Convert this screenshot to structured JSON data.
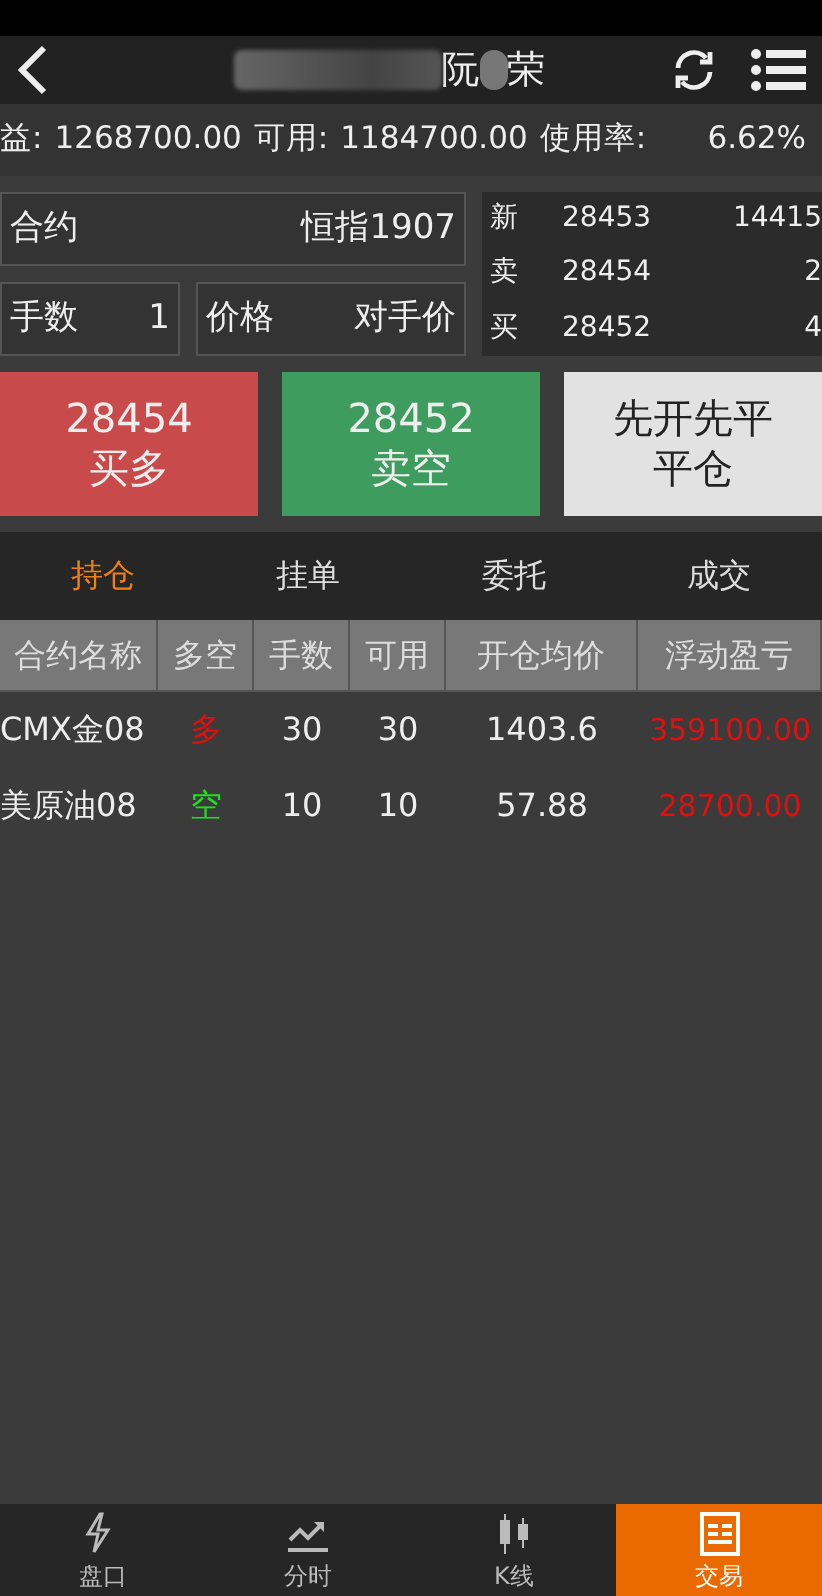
{
  "header": {
    "title_parts": [
      "阮",
      "荣"
    ]
  },
  "account": {
    "equity_label": "益:",
    "equity": "1268700.00",
    "available_label": "可用:",
    "available": "1184700.00",
    "usage_label": "使用率:",
    "usage": "6.62%"
  },
  "order": {
    "contract_label": "合约",
    "contract": "恒指1907",
    "qty_label": "手数",
    "qty": "1",
    "price_label": "价格",
    "price": "对手价"
  },
  "quote": [
    {
      "label": "新",
      "price": "28453",
      "volume": "14415"
    },
    {
      "label": "卖",
      "price": "28454",
      "volume": "2"
    },
    {
      "label": "买",
      "price": "28452",
      "volume": "4"
    }
  ],
  "actions": [
    {
      "kind": "buy",
      "price": "28454",
      "label": "买多"
    },
    {
      "kind": "sell",
      "price": "28452",
      "label": "卖空"
    },
    {
      "kind": "close",
      "price": "先开先平",
      "label": "平仓"
    }
  ],
  "tabs": [
    {
      "label": "持仓",
      "selected": true
    },
    {
      "label": "挂单",
      "selected": false
    },
    {
      "label": "委托",
      "selected": false
    },
    {
      "label": "成交",
      "selected": false
    }
  ],
  "table": {
    "columns": [
      "合约名称",
      "多空",
      "手数",
      "可用",
      "开仓均价",
      "浮动盈亏"
    ],
    "rows": [
      {
        "name": "CMX金08",
        "color": "#e01010",
        "direction": "多",
        "qty": "30",
        "available": "30",
        "avg_price": "1403.6",
        "pnl": "359100.00"
      },
      {
        "name": "美原油08",
        "color": "#22dd22",
        "direction": "空",
        "qty": "10",
        "available": "10",
        "avg_price": "57.88",
        "pnl": "28700.00"
      }
    ]
  },
  "nav": [
    {
      "kind": "bolt",
      "label": "盘口",
      "selected": false
    },
    {
      "kind": "trend",
      "label": "分时",
      "selected": false
    },
    {
      "kind": "candle",
      "label": "K线",
      "selected": false
    },
    {
      "kind": "list",
      "label": "交易",
      "selected": true
    }
  ]
}
